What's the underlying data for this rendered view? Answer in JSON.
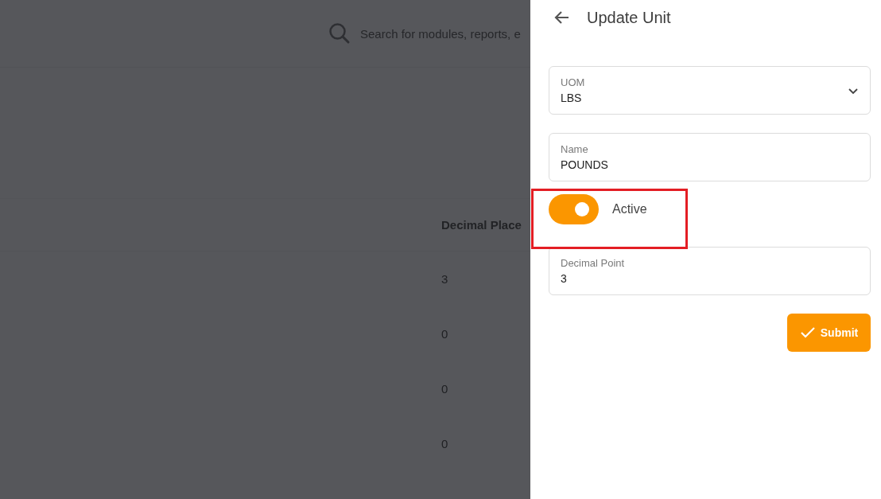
{
  "background": {
    "search": {
      "placeholder": "Search for modules, reports, e"
    },
    "table": {
      "columns": [
        "Decimal Place"
      ],
      "rows": [
        [
          "3"
        ],
        [
          "0"
        ],
        [
          "0"
        ],
        [
          "0"
        ]
      ]
    }
  },
  "panel": {
    "title": "Update Unit",
    "fields": [
      {
        "kind": "select",
        "label": "UOM",
        "value": "LBS"
      },
      {
        "kind": "text",
        "label": "Name",
        "value": "POUNDS"
      },
      {
        "kind": "toggle",
        "label": "Active",
        "on": true
      },
      {
        "kind": "text",
        "label": "Decimal Point",
        "value": "3"
      }
    ],
    "submit": "Submit"
  }
}
